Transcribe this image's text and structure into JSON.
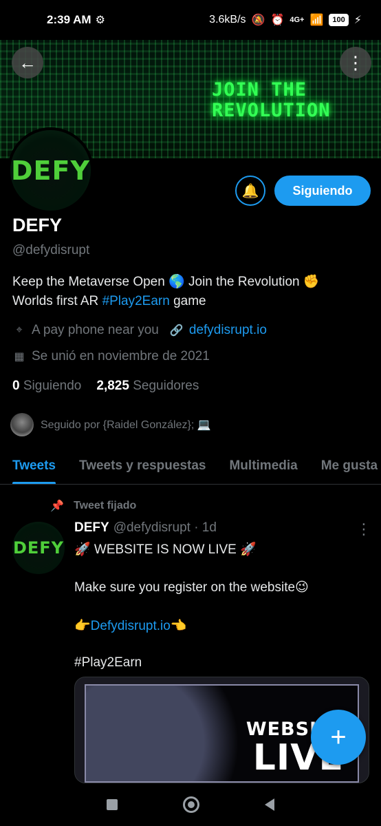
{
  "status_bar": {
    "time": "2:39 AM",
    "net_speed": "3.6kB/s",
    "signal_label": "4G+",
    "battery": "100"
  },
  "banner": {
    "text_line1": "JOIN THE",
    "text_line2": "REVOLUTION",
    "accent": "#33ff55"
  },
  "profile": {
    "logo_text": "DEFY",
    "name": "DEFY",
    "handle": "@defydisrupt",
    "follow_button": "Siguiendo",
    "bio_line1": "Keep the Metaverse Open 🌎 Join the Revolution ✊",
    "bio_line2_pre": "Worlds first AR ",
    "bio_hashtag": "#Play2Earn",
    "bio_line2_post": " game",
    "location": "A pay phone near you",
    "website": "defydisrupt.io",
    "joined": "Se unió en noviembre de 2021",
    "following_count": "0",
    "following_label": "Siguiendo",
    "followers_count": "2,825",
    "followers_label": "Seguidores",
    "followed_by": "Seguido por {Raidel González}; 💻"
  },
  "tabs": [
    {
      "label": "Tweets"
    },
    {
      "label": "Tweets y respuestas"
    },
    {
      "label": "Multimedia"
    },
    {
      "label": "Me gusta"
    }
  ],
  "tweet": {
    "pinned_label": "Tweet fijado",
    "avatar_text": "DEFY",
    "name": "DEFY",
    "meta": "@defydisrupt · 1d",
    "line1": "🚀 WEBSITE IS NOW LIVE 🚀",
    "line2": "Make sure you register on the website😉",
    "line3_pre": "👉",
    "line3_link": "Defydisrupt.io",
    "line3_post": "👈",
    "line4": "#Play2Earn",
    "media_title_top": "WEBSITE",
    "media_title_big": "LIVE"
  },
  "colors": {
    "accent": "#1d9bf0",
    "background": "#000000",
    "muted": "#71767b"
  }
}
